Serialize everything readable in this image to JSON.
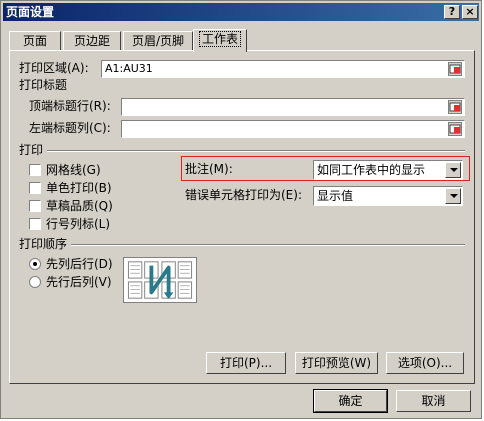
{
  "window": {
    "title": "页面设置",
    "help_label": "?",
    "close_label": "×"
  },
  "tabs": [
    {
      "label": "页面"
    },
    {
      "label": "页边距"
    },
    {
      "label": "页眉/页脚"
    },
    {
      "label": "工作表"
    }
  ],
  "print_area": {
    "label": "打印区域(A):",
    "value": "A1:AU31"
  },
  "print_titles": {
    "group_label": "打印标题",
    "top_rows_label": "顶端标题行(R):",
    "top_rows_value": "",
    "left_cols_label": "左端标题列(C):",
    "left_cols_value": ""
  },
  "print_section": {
    "group_label": "打印",
    "gridlines": "网格线(G)",
    "black_white": "单色打印(B)",
    "draft": "草稿品质(Q)",
    "row_col_headings": "行号列标(L)",
    "comments_label": "批注(M):",
    "comments_value": "如同工作表中的显示",
    "errors_label": "错误单元格打印为(E):",
    "errors_value": "显示值"
  },
  "page_order": {
    "group_label": "打印顺序",
    "down_then_over": "先列后行(D)",
    "over_then_down": "先行后列(V)"
  },
  "actions": {
    "print": "打印(P)...",
    "preview": "打印预览(W)",
    "options": "选项(O)..."
  },
  "footer": {
    "ok": "确定",
    "cancel": "取消"
  }
}
